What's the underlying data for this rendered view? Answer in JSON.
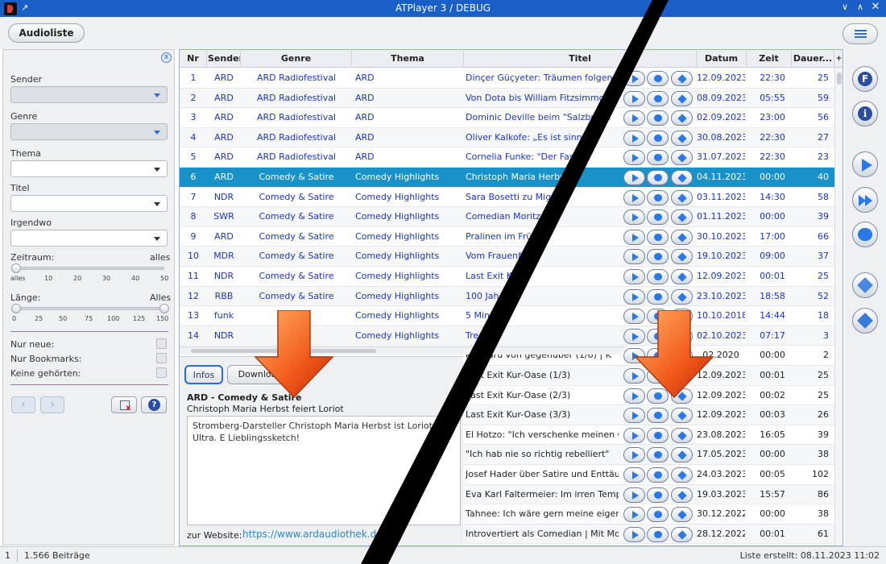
{
  "window": {
    "title": "ATPlayer 3 / DEBUG"
  },
  "toolbar": {
    "audioliste_label": "Audioliste"
  },
  "filter": {
    "sender_label": "Sender",
    "genre_label": "Genre",
    "thema_label": "Thema",
    "titel_label": "Titel",
    "irgendwo_label": "Irgendwo",
    "zeitraum_label": "Zeitraum:",
    "zeitraum_value": "alles",
    "zeitraum_ticks": [
      "alles",
      "10",
      "20",
      "30",
      "40",
      "50"
    ],
    "laenge_label": "Länge:",
    "laenge_value": "Alles",
    "laenge_ticks": [
      "0",
      "25",
      "50",
      "75",
      "100",
      "125",
      "150"
    ],
    "nur_neue": "Nur neue:",
    "nur_bookmarks": "Nur Bookmarks:",
    "keine_gehoerten": "Keine gehörten:",
    "help_label": "?"
  },
  "table": {
    "headers": [
      "Nr",
      "Sender",
      "Genre",
      "Thema",
      "Titel",
      "Datum",
      "Zeit",
      "Dauer..."
    ],
    "rows": [
      {
        "nr": "1",
        "sender": "ARD",
        "genre": "ARD Radiofestival",
        "thema": "ARD",
        "titel": "Dinçer Güçyeter: Träumen folgen | D",
        "datum": "12.09.2023",
        "zeit": "22:30",
        "dauer": "25"
      },
      {
        "nr": "2",
        "sender": "ARD",
        "genre": "ARD Radiofestival",
        "thema": "ARD",
        "titel": "Von Dota bis William Fitzsimmons",
        "datum": "08.09.2023",
        "zeit": "05:55",
        "dauer": "59"
      },
      {
        "nr": "3",
        "sender": "ARD",
        "genre": "ARD Radiofestival",
        "thema": "ARD",
        "titel": "Dominic Deville beim \"Salzburge",
        "datum": "02.09.2023",
        "zeit": "23:00",
        "dauer": "56"
      },
      {
        "nr": "4",
        "sender": "ARD",
        "genre": "ARD Radiofestival",
        "thema": "ARD",
        "titel": "Oliver Kalkofe: „Es ist sinnvoll",
        "datum": "30.08.2023",
        "zeit": "22:30",
        "dauer": "27"
      },
      {
        "nr": "5",
        "sender": "ARD",
        "genre": "ARD Radiofestival",
        "thema": "ARD",
        "titel": "Cornelia Funke: \"Der Fasch",
        "datum": "31.07.2023",
        "zeit": "22:30",
        "dauer": "23"
      },
      {
        "nr": "6",
        "sender": "ARD",
        "genre": "Comedy & Satire",
        "thema": "Comedy Highlights",
        "titel": "Christoph Maria Herbst",
        "datum": "04.11.2023",
        "zeit": "00:00",
        "dauer": "40"
      },
      {
        "nr": "7",
        "sender": "NDR",
        "genre": "Comedy & Satire",
        "thema": "Comedy Highlights",
        "titel": "Sara Bosetti zu Migra",
        "datum": "03.11.2023",
        "zeit": "14:30",
        "dauer": "58"
      },
      {
        "nr": "8",
        "sender": "SWR",
        "genre": "Comedy & Satire",
        "thema": "Comedy Highlights",
        "titel": "Comedian Moritz M",
        "datum": "01.11.2023",
        "zeit": "00:00",
        "dauer": "39"
      },
      {
        "nr": "9",
        "sender": "ARD",
        "genre": "Comedy & Satire",
        "thema": "Comedy Highlights",
        "titel": "Pralinen im Früh",
        "datum": "30.10.2023",
        "zeit": "17:00",
        "dauer": "66"
      },
      {
        "nr": "10",
        "sender": "MDR",
        "genre": "Comedy & Satire",
        "thema": "Comedy Highlights",
        "titel": "Vom Frauenfo",
        "datum": "19.10.2023",
        "zeit": "09:00",
        "dauer": "37"
      },
      {
        "nr": "11",
        "sender": "NDR",
        "genre": "Comedy & Satire",
        "thema": "Comedy Highlights",
        "titel": "Last Exit Ku",
        "datum": "12.09.2023",
        "zeit": "00:01",
        "dauer": "25"
      },
      {
        "nr": "12",
        "sender": "RBB",
        "genre": "Comedy & Satire",
        "thema": "Comedy Highlights",
        "titel": "100 Jah",
        "datum": "23.10.2023",
        "zeit": "18:58",
        "dauer": "52"
      },
      {
        "nr": "13",
        "sender": "funk",
        "genre": "Co",
        "thema": "Comedy Highlights",
        "titel": "5 Min",
        "datum": "10.10.2018",
        "zeit": "14:44",
        "dauer": "18"
      },
      {
        "nr": "14",
        "sender": "NDR",
        "genre": "Co",
        "thema": "Comedy Highlights",
        "titel": "Tre",
        "datum": "02.10.2023",
        "zeit": "07:17",
        "dauer": "3"
      },
      {
        "nr": "",
        "sender": "",
        "genre": "",
        "thema": "",
        "titel": "Känguru von gegenüber (1/6) | K",
        "datum": "02.2020",
        "zeit": "00:00",
        "dauer": "2"
      },
      {
        "nr": "",
        "sender": "",
        "genre": "",
        "thema": "",
        "titel": "Last Exit Kur-Oase (1/3)",
        "datum": "12.09.2023",
        "zeit": "00:01",
        "dauer": "25"
      },
      {
        "nr": "",
        "sender": "",
        "genre": "",
        "thema": "",
        "titel": "Last Exit Kur-Oase (2/3)",
        "datum": "12.09.2023",
        "zeit": "00:02",
        "dauer": "25"
      },
      {
        "nr": "",
        "sender": "",
        "genre": "",
        "thema": "",
        "titel": "Last Exit Kur-Oase (3/3)",
        "datum": "12.09.2023",
        "zeit": "00:03",
        "dauer": "26"
      },
      {
        "nr": "",
        "sender": "",
        "genre": "",
        "thema": "",
        "titel": "El Hotzo: \"Ich verschenke meinen Con...",
        "datum": "23.08.2023",
        "zeit": "16:05",
        "dauer": "39"
      },
      {
        "nr": "",
        "sender": "",
        "genre": "",
        "thema": "",
        "titel": "\"Ich hab nie so richtig rebelliert\"",
        "datum": "17.05.2023",
        "zeit": "00:00",
        "dauer": "38"
      },
      {
        "nr": "",
        "sender": "",
        "genre": "",
        "thema": "",
        "titel": "Josef Hader über Satire und Enttäusc...",
        "datum": "24.03.2023",
        "zeit": "00:05",
        "dauer": "102"
      },
      {
        "nr": "",
        "sender": "",
        "genre": "",
        "thema": "",
        "titel": "Eva Karl Faltermeier: Im irren Tempo ...",
        "datum": "19.03.2023",
        "zeit": "15:57",
        "dauer": "86"
      },
      {
        "nr": "",
        "sender": "",
        "genre": "",
        "thema": "",
        "titel": "Tahnee: Ich wäre gern meine eigene ...",
        "datum": "30.12.2022",
        "zeit": "00:00",
        "dauer": "38"
      },
      {
        "nr": "",
        "sender": "",
        "genre": "",
        "thema": "",
        "titel": "Introvertiert als Comedian | Mit Morit...",
        "datum": "28.12.2022",
        "zeit": "00:01",
        "dauer": "61"
      }
    ]
  },
  "detail": {
    "tab_infos": "Infos",
    "tab_download": "Download",
    "header": "ARD  -  Comedy & Satire",
    "subtitle": "Christoph Maria Herbst feiert Loriot",
    "text": "Stromberg-Darsteller Christoph Maria Herbst ist Loriot-Ultra. E Lieblingssketch!",
    "website_label": "zur Website:",
    "website_url": "https://www.ardaudiothek.de/"
  },
  "right_toolbar": {
    "filter_letter": "F",
    "info_letter": "i"
  },
  "status": {
    "selected": "1",
    "count": "1.566 Beiträge",
    "list_created": "Liste erstellt: 08.11.2023 11:02"
  },
  "colors": {
    "titlebar": "#1a5fc8",
    "selection": "#1892c8",
    "link_text": "#1a34c8",
    "accent": "#2a78e8"
  }
}
